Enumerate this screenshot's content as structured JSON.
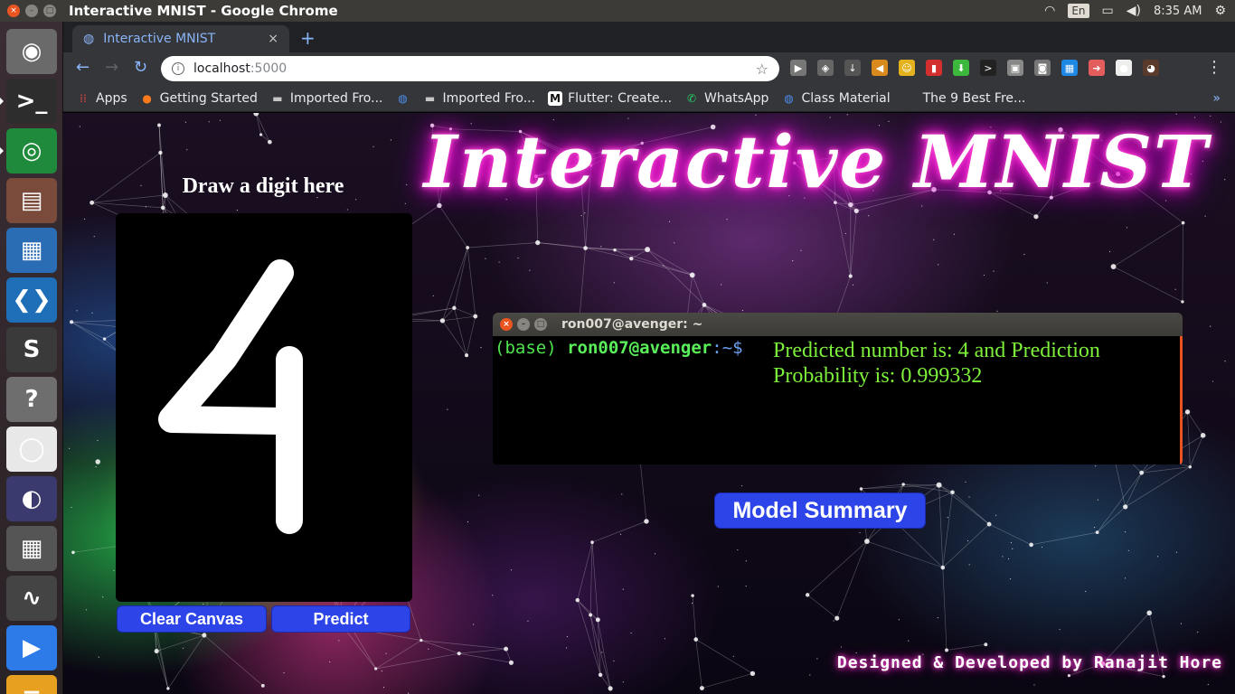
{
  "window": {
    "title": "Interactive MNIST - Google Chrome",
    "close": "×",
    "min": "–",
    "max": "□"
  },
  "tray": {
    "lang": "En",
    "time": "8:35 AM",
    "wifi_icon": "wifi-icon",
    "battery_icon": "battery-icon",
    "volume_icon": "volume-icon",
    "settings_icon": "gear-icon"
  },
  "launcher": {
    "items": [
      {
        "name": "ubuntu-dash",
        "glyph": "◉",
        "color": "#6a6a6a"
      },
      {
        "name": "terminal",
        "glyph": ">_",
        "color": "#2d2d2d"
      },
      {
        "name": "chrome",
        "glyph": "◎",
        "color": "#1f8a3c"
      },
      {
        "name": "files",
        "glyph": "▤",
        "color": "#7a4a3a"
      },
      {
        "name": "writer",
        "glyph": "▦",
        "color": "#2a6db5"
      },
      {
        "name": "vscode",
        "glyph": "❮❯",
        "color": "#1e6fb8"
      },
      {
        "name": "sublime",
        "glyph": "S",
        "color": "#3a3a3a"
      },
      {
        "name": "help",
        "glyph": "?",
        "color": "#6e6e6e"
      },
      {
        "name": "app-circle",
        "glyph": "◯",
        "color": "#e8e8e8"
      },
      {
        "name": "eclipse",
        "glyph": "◐",
        "color": "#3b3a6e"
      },
      {
        "name": "calculator",
        "glyph": "▦",
        "color": "#555"
      },
      {
        "name": "monitor",
        "glyph": "∿",
        "color": "#444"
      },
      {
        "name": "zoom",
        "glyph": "▶",
        "color": "#2d7be8"
      },
      {
        "name": "stack",
        "glyph": "≡",
        "color": "#e8a020"
      }
    ]
  },
  "browser": {
    "tab_title": "Interactive MNIST",
    "tab_close": "×",
    "new_tab": "+",
    "back": "←",
    "forward": "→",
    "reload": "↻",
    "info": "i",
    "url_host": "localhost",
    "url_port": ":5000",
    "star": "☆",
    "menu": "⋮",
    "bookmarks": [
      {
        "label": "Apps",
        "icon": "apps-grid-icon",
        "glyph": "⁞⁞",
        "color": "#e8453c"
      },
      {
        "label": "Getting Started",
        "icon": "firefox-icon",
        "glyph": "●",
        "color": "#ff7a1a"
      },
      {
        "label": "Imported Fro...",
        "icon": "folder-icon",
        "glyph": "▬",
        "color": "#c7c7c7"
      },
      {
        "label": "",
        "icon": "globe-icon",
        "glyph": "◍",
        "color": "#4d8df0"
      },
      {
        "label": "Imported Fro...",
        "icon": "folder-icon",
        "glyph": "▬",
        "color": "#c7c7c7"
      },
      {
        "label": "Flutter: Create...",
        "icon": "medium-icon",
        "glyph": "M",
        "color": "#111"
      },
      {
        "label": "WhatsApp",
        "icon": "whatsapp-icon",
        "glyph": "✆",
        "color": "#25d366"
      },
      {
        "label": "Class Material",
        "icon": "globe-icon",
        "glyph": "◍",
        "color": "#4d8df0"
      },
      {
        "label": "The 9 Best Fre...",
        "icon": "site-icon",
        "glyph": "",
        "color": "#35363a"
      }
    ],
    "bookmarks_more": "»",
    "extensions": [
      {
        "name": "play-ext-icon",
        "glyph": "▶",
        "color": "#777"
      },
      {
        "name": "shield-ext-icon",
        "glyph": "◈",
        "color": "#666"
      },
      {
        "name": "download-ext-icon",
        "glyph": "↓",
        "color": "#555"
      },
      {
        "name": "speaker-ext-icon",
        "glyph": "◀",
        "color": "#d88a1c"
      },
      {
        "name": "face-ext-icon",
        "glyph": "☺",
        "color": "#e4b21c"
      },
      {
        "name": "red-ext-icon",
        "glyph": "▮",
        "color": "#d32f2f"
      },
      {
        "name": "green-arrow-ext-icon",
        "glyph": "⬇",
        "color": "#3cb83c"
      },
      {
        "name": "terminal-ext-icon",
        "glyph": ">",
        "color": "#222"
      },
      {
        "name": "image-ext-icon",
        "glyph": "▣",
        "color": "#888"
      },
      {
        "name": "camera-ext-icon",
        "glyph": "◙",
        "color": "#777"
      },
      {
        "name": "grid-ext-icon",
        "glyph": "▦",
        "color": "#1e88e5"
      },
      {
        "name": "cast-ext-icon",
        "glyph": "➜",
        "color": "#e35d5d"
      },
      {
        "name": "flag-ext-icon",
        "glyph": "●",
        "color": "#eee"
      },
      {
        "name": "profile-avatar",
        "glyph": "◕",
        "color": "#5a3a2a"
      }
    ]
  },
  "app": {
    "title": "Interactive MNIST",
    "draw_label": "Draw a digit here",
    "clear_button": "Clear Canvas",
    "predict_button": "Predict",
    "summary_button": "Model Summary",
    "drawn_digit": "4",
    "credit": "Designed & Developed by Ranajit Hore"
  },
  "terminal": {
    "title": "ron007@avenger: ~",
    "close": "×",
    "min": "–",
    "max": "□",
    "prompt_env": "(base)",
    "prompt_user": "ron007@avenger",
    "prompt_path": ":~$",
    "output": "Predicted number is: 4 and Prediction Probability is: 0.999332",
    "predicted_number": 4,
    "probability": 0.999332
  }
}
